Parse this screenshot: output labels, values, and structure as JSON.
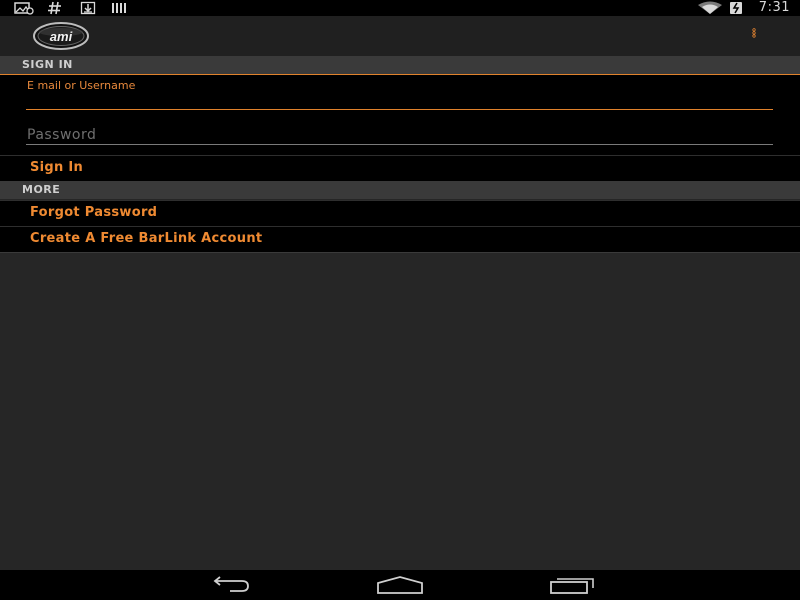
{
  "status_bar": {
    "time": "7:31",
    "left_icons": [
      "gallery-notification-icon",
      "hashtag-notification-icon",
      "download-notification-icon",
      "barcode-notification-icon"
    ],
    "right_icons": [
      "wifi-icon",
      "battery-charging-icon"
    ]
  },
  "action_bar": {
    "logo_text": "ami",
    "menu_icon": "overflow-menu-icon"
  },
  "sign_in_section": {
    "header": "SIGN IN",
    "email_label": "E mail or Username",
    "email_value": "",
    "password_placeholder": "Password",
    "sign_in_button": "Sign In"
  },
  "more_section": {
    "header": "MORE",
    "forgot_password": "Forgot Password",
    "create_account": "Create A Free BarLink Account"
  },
  "nav_bar": {
    "icons": [
      "back-icon",
      "home-icon",
      "recent-apps-icon"
    ]
  },
  "colors": {
    "accent": "#ef8a32",
    "background": "#262626",
    "section_header_bg": "#3a3a3a",
    "row_bg": "#000000"
  }
}
